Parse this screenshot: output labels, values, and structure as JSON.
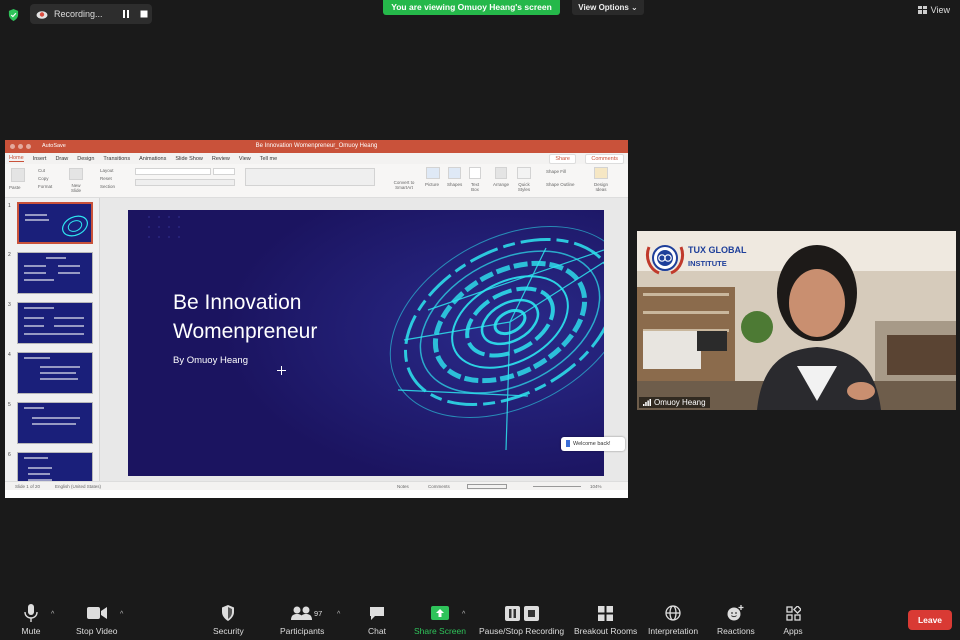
{
  "top": {
    "recording_label": "Recording...",
    "banner": "You are viewing Omuoy Heang's screen",
    "view_options": "View Options",
    "view_label": "View"
  },
  "ppt": {
    "autosave": "AutoSave",
    "document_title": "Be Innovation Womenpreneur_Omuoy Heang",
    "tabs": [
      "Home",
      "Insert",
      "Draw",
      "Design",
      "Transitions",
      "Animations",
      "Slide Show",
      "Review",
      "View",
      "Tell me"
    ],
    "share": "Share",
    "comments": "Comments",
    "ribbon": {
      "paste": "Paste",
      "cut": "Cut",
      "copy": "Copy",
      "format": "Format",
      "new_slide": "New Slide",
      "layout": "Layout",
      "reset": "Reset",
      "section": "Section",
      "picture": "Picture",
      "shapes": "Shapes",
      "text_box": "Text Box",
      "arrange": "Arrange",
      "quick_styles": "Quick Styles",
      "shape_fill": "Shape Fill",
      "shape_outline": "Shape Outline",
      "design_ideas": "Design Ideas",
      "convert_smartart": "Convert to SmartArt"
    },
    "slide_numbers": [
      "1",
      "2",
      "3",
      "4",
      "5",
      "6"
    ],
    "slide": {
      "title_line1": "Be Innovation",
      "title_line2": "Womenpreneur",
      "byline": "By Omuoy Heang"
    },
    "welcome_back": "Welcome back!",
    "status": {
      "slide_count": "Slide 1 of 20",
      "language": "English (United States)",
      "notes": "Notes",
      "comments": "Comments",
      "zoom": "104%"
    },
    "colors": {
      "accent": "#c9523a",
      "slide_bg": "#1e1664",
      "cyan": "#2ee6f0"
    }
  },
  "cam": {
    "participant_name": "Omuoy Heang",
    "logo_line1": "TUX GLOBAL",
    "logo_line2": "INSTITUTE"
  },
  "toolbar": {
    "mute": "Mute",
    "stop_video": "Stop Video",
    "security": "Security",
    "participants": "Participants",
    "participant_count": "97",
    "chat": "Chat",
    "share_screen": "Share Screen",
    "pause_stop_recording": "Pause/Stop Recording",
    "breakout_rooms": "Breakout Rooms",
    "interpretation": "Interpretation",
    "reactions": "Reactions",
    "apps": "Apps",
    "leave": "Leave",
    "colors": {
      "green": "#2fc35a",
      "leave_red": "#d93a34"
    }
  }
}
